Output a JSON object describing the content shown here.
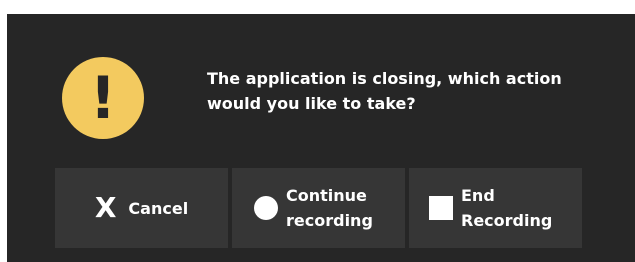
{
  "dialog": {
    "icon": "warning-exclamation-icon",
    "icon_glyph": "!",
    "accent_color": "#f3ca5f",
    "message_line1": "The application is closing, which action",
    "message_line2": "would you like to take?"
  },
  "buttons": {
    "cancel": {
      "icon": "close-x-icon",
      "glyph": "X",
      "label": "Cancel"
    },
    "continue": {
      "icon": "circle-record-icon",
      "label_line1": "Continue",
      "label_line2": "recording"
    },
    "end": {
      "icon": "square-stop-icon",
      "label_line1": "End",
      "label_line2": "Recording"
    }
  }
}
